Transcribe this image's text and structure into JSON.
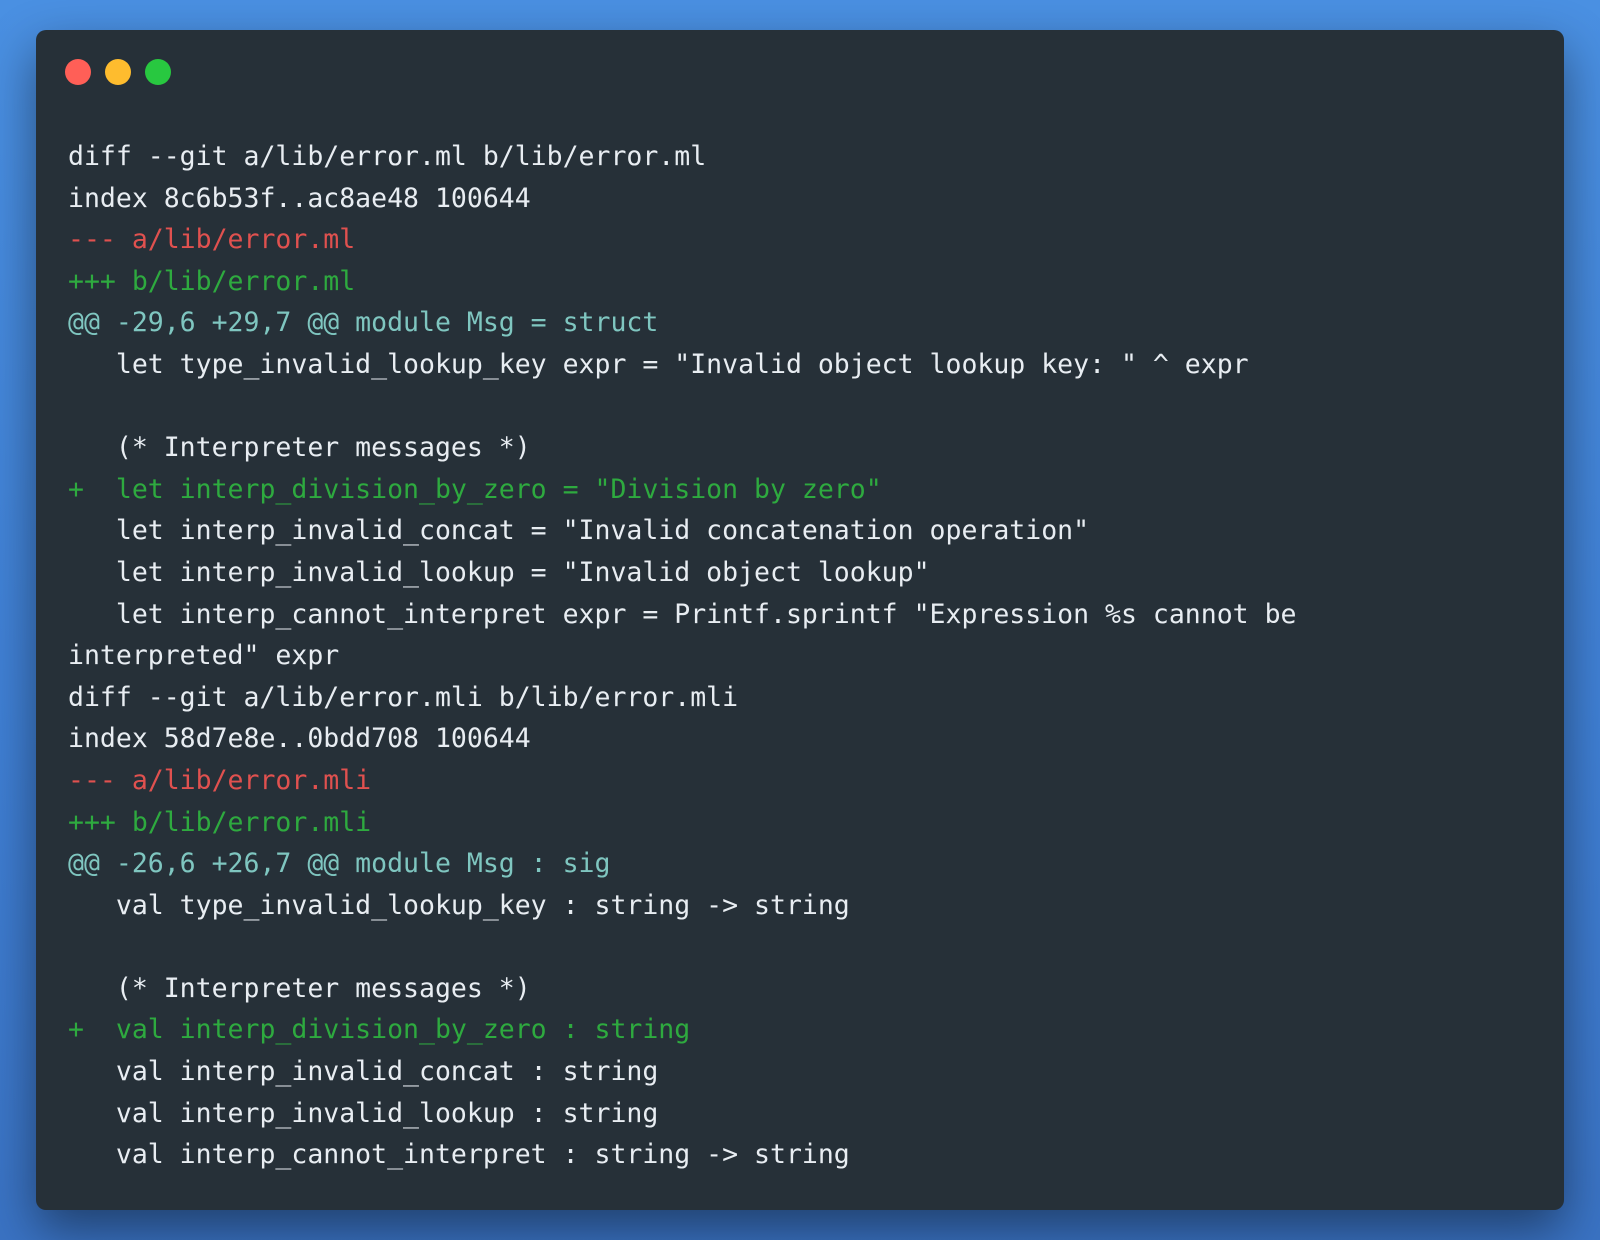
{
  "window": {
    "controls": {
      "close_color": "#ff5f57",
      "minimize_color": "#febc2e",
      "zoom_color": "#28c840"
    },
    "background": "#263038"
  },
  "colors": {
    "text": "#e8edf2",
    "removed": "#e0514f",
    "added": "#2eaa3f",
    "hunk": "#7fc6c0"
  },
  "diff": {
    "lines": [
      {
        "kind": "header",
        "text": "diff --git a/lib/error.ml b/lib/error.ml"
      },
      {
        "kind": "meta",
        "text": "index 8c6b53f..ac8ae48 100644"
      },
      {
        "kind": "del-file",
        "text": "--- a/lib/error.ml"
      },
      {
        "kind": "add-file",
        "text": "+++ b/lib/error.ml"
      },
      {
        "kind": "hunk",
        "text": "@@ -29,6 +29,7 @@ module Msg = struct"
      },
      {
        "kind": "context",
        "text": "   let type_invalid_lookup_key expr = \"Invalid object lookup key: \" ^ expr"
      },
      {
        "kind": "blank",
        "text": " "
      },
      {
        "kind": "context",
        "text": "   (* Interpreter messages *)"
      },
      {
        "kind": "added",
        "text": "+  let interp_division_by_zero = \"Division by zero\""
      },
      {
        "kind": "context",
        "text": "   let interp_invalid_concat = \"Invalid concatenation operation\""
      },
      {
        "kind": "context",
        "text": "   let interp_invalid_lookup = \"Invalid object lookup\""
      },
      {
        "kind": "context",
        "text": "   let interp_cannot_interpret expr = Printf.sprintf \"Expression %s cannot be"
      },
      {
        "kind": "context",
        "text": "interpreted\" expr"
      },
      {
        "kind": "header",
        "text": "diff --git a/lib/error.mli b/lib/error.mli"
      },
      {
        "kind": "meta",
        "text": "index 58d7e8e..0bdd708 100644"
      },
      {
        "kind": "del-file",
        "text": "--- a/lib/error.mli"
      },
      {
        "kind": "add-file",
        "text": "+++ b/lib/error.mli"
      },
      {
        "kind": "hunk",
        "text": "@@ -26,6 +26,7 @@ module Msg : sig"
      },
      {
        "kind": "context",
        "text": "   val type_invalid_lookup_key : string -> string"
      },
      {
        "kind": "blank",
        "text": " "
      },
      {
        "kind": "context",
        "text": "   (* Interpreter messages *)"
      },
      {
        "kind": "added",
        "text": "+  val interp_division_by_zero : string"
      },
      {
        "kind": "context",
        "text": "   val interp_invalid_concat : string"
      },
      {
        "kind": "context",
        "text": "   val interp_invalid_lookup : string"
      },
      {
        "kind": "context",
        "text": "   val interp_cannot_interpret : string -> string"
      }
    ]
  }
}
